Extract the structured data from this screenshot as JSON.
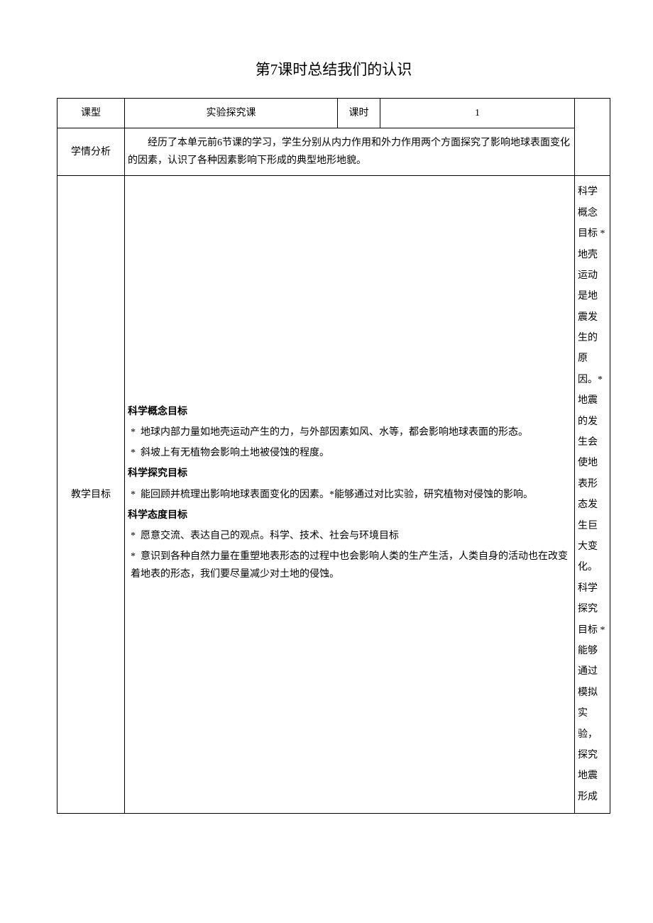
{
  "title": "第7课时总结我们的认识",
  "rows": {
    "type": {
      "label": "课型",
      "value": "实验探究课",
      "periodLabel": "课时",
      "periodValue": "1"
    },
    "analysis": {
      "label": "学情分析",
      "text": "经历了本单元前6节课的学习，学生分别从内力作用和外力作用两个方面探究了影响地球表面变化的因素，认识了各种因素影响下形成的典型地形地貌。"
    },
    "goals": {
      "label": "教学目标",
      "sections": [
        {
          "head": "科学概念目标",
          "bullets": [
            "地球内部力量如地壳运动产生的力，与外部因素如风、水等，都会影响地球表面的形态。",
            "斜坡上有无植物会影响土地被侵蚀的程度。"
          ]
        },
        {
          "head": "科学探究目标",
          "bullets": [
            "能回顾并梳理出影响地球表面变化的因素。*能够通过对比实验，研究植物对侵蚀的影响。"
          ]
        },
        {
          "head": "科学态度目标",
          "bullets": [
            "愿意交流、表达自己的观点。科学、技术、社会与环境目标",
            "意识到各种自然力量在重塑地表形态的过程中也会影响人类的生产生活，人类自身的活动也在改变着地表的形态，我们要尽量减少对土地的侵蚀。"
          ]
        }
      ]
    },
    "side": {
      "text": "科学概念目标 *地壳运动是地震发生的原因。*地震的发生会使地表形态发生巨大变化。科学探究目标 *能够通过模拟实验，探究地震形成"
    }
  }
}
